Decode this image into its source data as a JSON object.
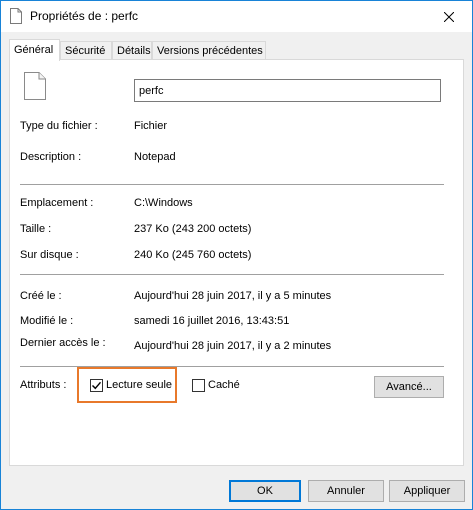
{
  "window": {
    "title": "Propriétés de : perfc"
  },
  "tabs": [
    {
      "label": "Général",
      "active": true
    },
    {
      "label": "Sécurité",
      "active": false
    },
    {
      "label": "Détails",
      "active": false
    },
    {
      "label": "Versions précédentes",
      "active": false
    }
  ],
  "general": {
    "file_name": "perfc",
    "type_label": "Type du fichier :",
    "type_value": "Fichier",
    "description_label": "Description :",
    "description_value": "Notepad",
    "location_label": "Emplacement :",
    "location_value": "C:\\Windows",
    "size_label": "Taille :",
    "size_value": "237 Ko (243 200 octets)",
    "disk_label": "Sur disque :",
    "disk_value": "240 Ko (245 760 octets)",
    "created_label": "Créé le :",
    "created_value": "Aujourd'hui 28 juin 2017, il y a 5 minutes",
    "modified_label": "Modifié le :",
    "modified_value": "samedi 16 juillet 2016, 13:43:51",
    "accessed_label": "Dernier accès le :",
    "accessed_value": "Aujourd'hui 28 juin 2017, il y a 2 minutes",
    "attributes_label": "Attributs :",
    "readonly_label": "Lecture seule",
    "readonly_checked": true,
    "hidden_label": "Caché",
    "hidden_checked": false,
    "advanced_label": "Avancé..."
  },
  "buttons": {
    "ok": "OK",
    "cancel": "Annuler",
    "apply": "Appliquer"
  },
  "colors": {
    "accent": "#0078d7",
    "highlight": "#e8792b"
  }
}
